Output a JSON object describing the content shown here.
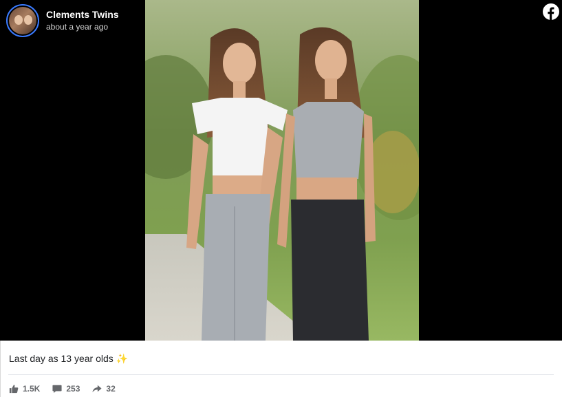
{
  "post": {
    "author": "Clements Twins",
    "time": "about a year ago",
    "caption": "Last day as 13 year olds",
    "caption_emoji": "✨"
  },
  "stats": {
    "likes": "1.5K",
    "comments": "253",
    "shares": "32"
  },
  "icons": {
    "brand": "facebook-icon",
    "like": "thumbs-up-icon",
    "comment": "comment-icon",
    "share": "share-arrow-icon"
  },
  "colors": {
    "facebook_brand": "#ffffff",
    "avatar_ring": "#3b7bff",
    "text_primary": "#1c1e21",
    "text_secondary": "#65676b"
  }
}
